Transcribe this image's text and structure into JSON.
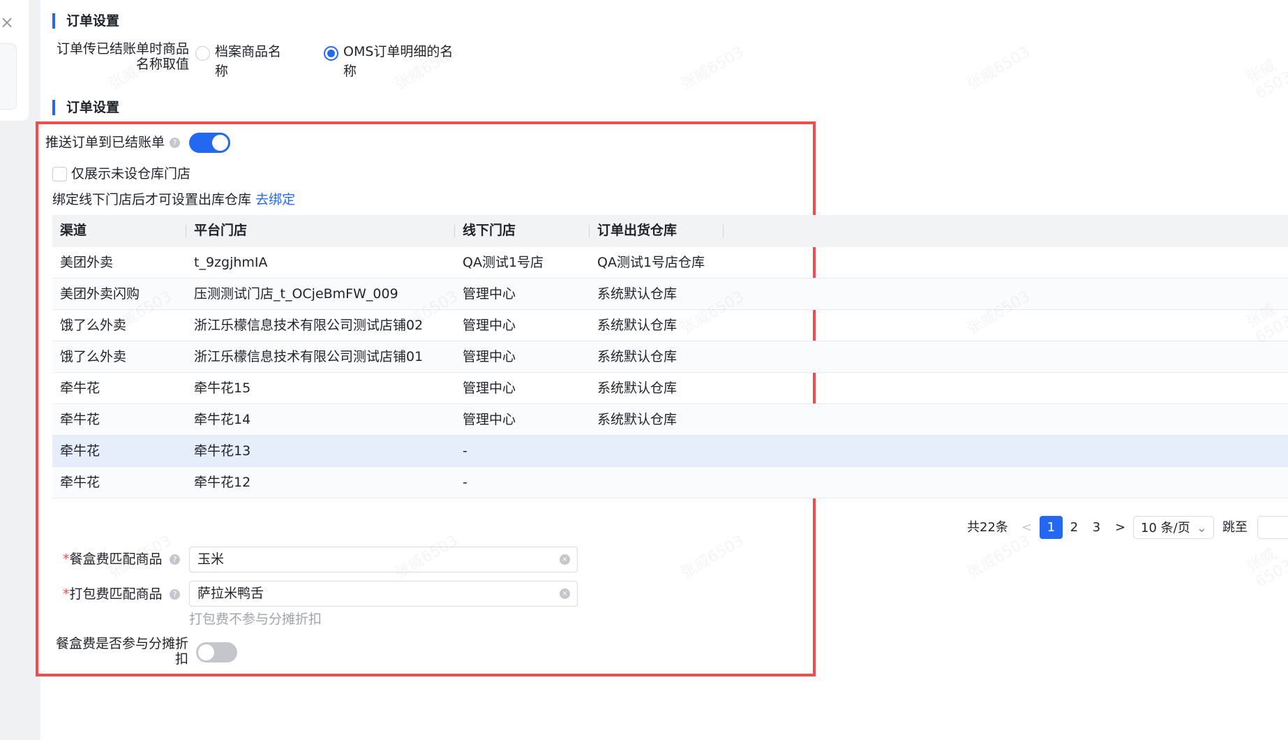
{
  "close_icon": "×",
  "section1": {
    "title": "订单设置",
    "field_label": "订单传已结账单时商品名称取值",
    "options": [
      {
        "label": "档案商品名称",
        "selected": false
      },
      {
        "label": "OMS订单明细的名称",
        "selected": true
      }
    ]
  },
  "section2": {
    "title": "订单设置",
    "push_label": "推送订单到已结账单",
    "push_enabled": true,
    "only_unset_label": "仅展示未设仓库门店",
    "only_unset_checked": false,
    "bind_hint": "绑定线下门店后才可设置出库仓库",
    "bind_link": "去绑定",
    "table": {
      "headers": [
        "渠道",
        "平台门店",
        "线下门店",
        "订单出货仓库"
      ],
      "rows": [
        [
          "美团外卖",
          "t_9zgjhmIA",
          "QA测试1号店",
          "QA测试1号店仓库"
        ],
        [
          "美团外卖闪购",
          "压测测试门店_t_OCjeBmFW_009",
          "管理中心",
          "系统默认仓库"
        ],
        [
          "饿了么外卖",
          "浙江乐檬信息技术有限公司测试店铺02",
          "管理中心",
          "系统默认仓库"
        ],
        [
          "饿了么外卖",
          "浙江乐檬信息技术有限公司测试店铺01",
          "管理中心",
          "系统默认仓库"
        ],
        [
          "牵牛花",
          "牵牛花15",
          "管理中心",
          "系统默认仓库"
        ],
        [
          "牵牛花",
          "牵牛花14",
          "管理中心",
          "系统默认仓库"
        ],
        [
          "牵牛花",
          "牵牛花13",
          "-",
          ""
        ],
        [
          "牵牛花",
          "牵牛花12",
          "-",
          ""
        ]
      ]
    },
    "pagination": {
      "total": "共22条",
      "pages": [
        "1",
        "2",
        "3"
      ],
      "current": "1",
      "page_size": "10 条/页",
      "jump_label": "跳至",
      "jump_value": ""
    },
    "box_fee": {
      "required": "*",
      "label": "餐盒费匹配商品",
      "value": "玉米"
    },
    "pack_fee": {
      "required": "*",
      "label": "打包费匹配商品",
      "value": "萨拉米鸭舌",
      "hint": "打包费不参与分摊折扣"
    },
    "box_fee_discount": {
      "label": "餐盒费是否参与分摊折扣",
      "enabled": false
    }
  },
  "watermark": "张威6503",
  "accent": "#2468f2"
}
